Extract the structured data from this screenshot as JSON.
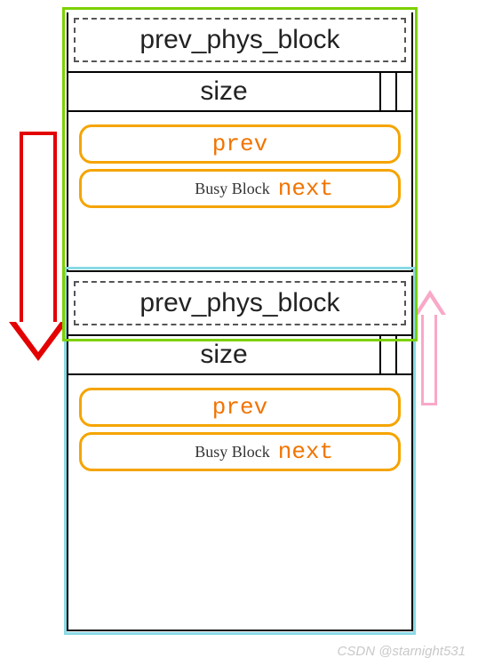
{
  "block1": {
    "prev_phys_block": "prev_phys_block",
    "size": "size",
    "prev": "prev",
    "busy": "Busy Block",
    "next": "next"
  },
  "block2": {
    "prev_phys_block": "prev_phys_block",
    "size": "size",
    "prev": "prev",
    "busy": "Busy Block",
    "next": "next"
  },
  "watermark": "CSDN @starnight531"
}
